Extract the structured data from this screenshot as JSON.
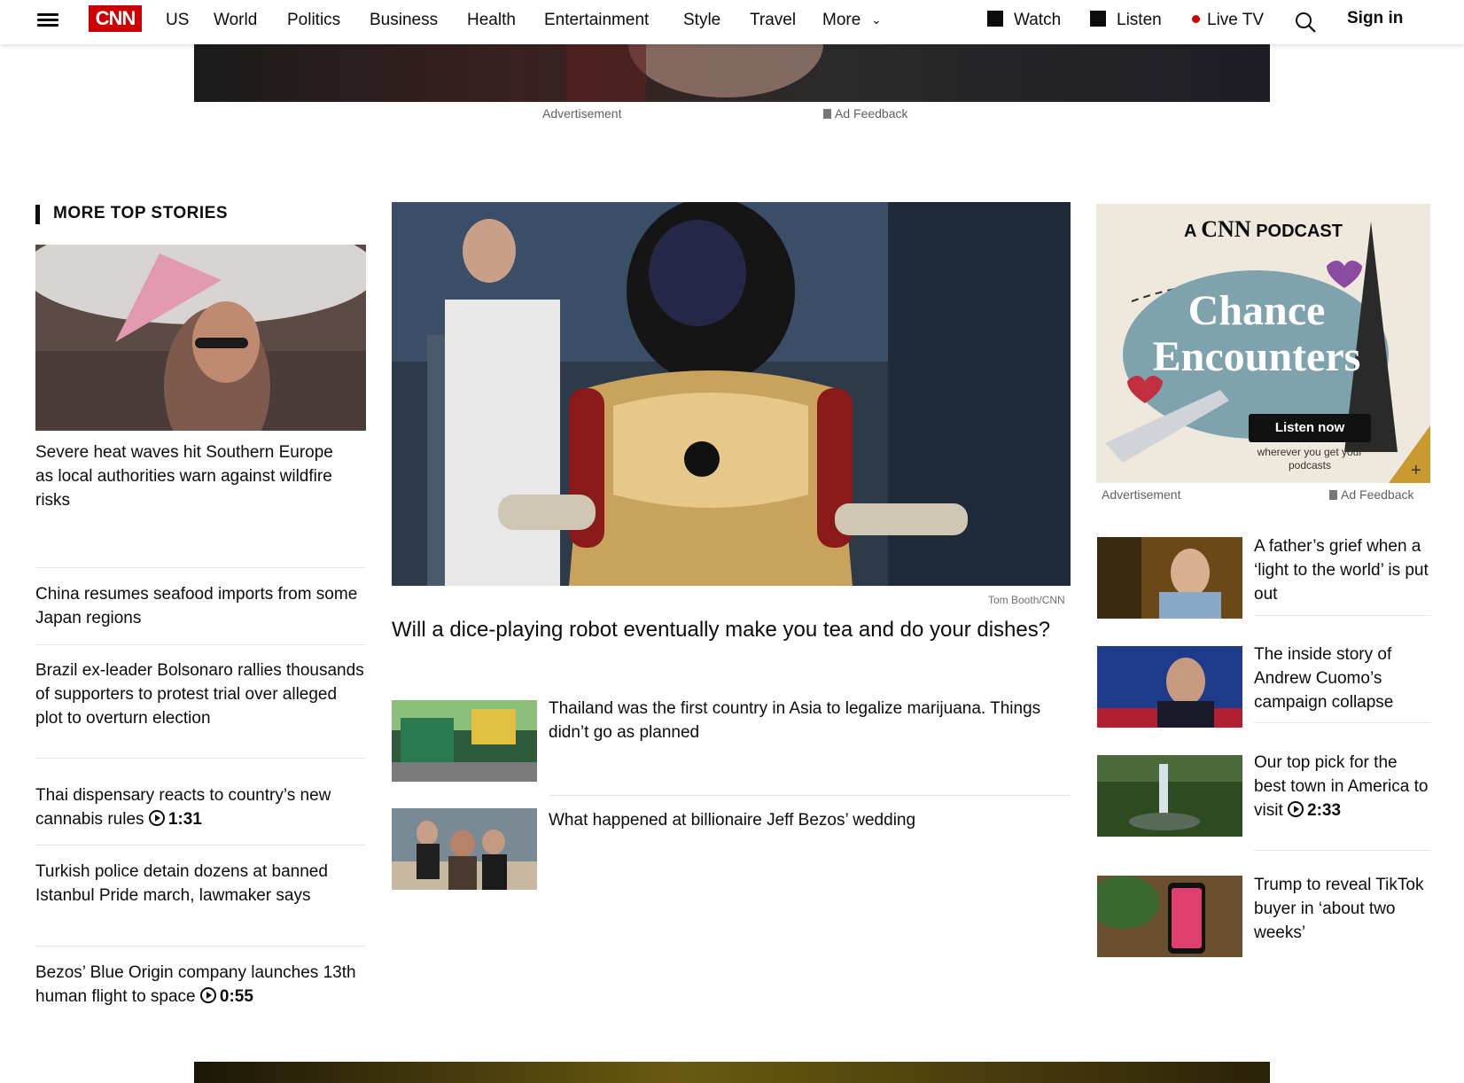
{
  "nav": {
    "menu_icon": "hamburger-icon",
    "logo": "CNN",
    "items": [
      "US",
      "World",
      "Politics",
      "Business",
      "Health",
      "Entertainment",
      "Style",
      "Travel",
      "More"
    ],
    "watch": "Watch",
    "listen": "Listen",
    "live_tv": "Live TV",
    "sign_in": "Sign in"
  },
  "top_ad": {
    "label": "Advertisement",
    "feedback": "Ad Feedback"
  },
  "more_top_stories": {
    "title": "MORE TOP STORIES",
    "stories": [
      {
        "headline": "Severe heat waves hit Southern Europe as local authorities warn against wildfire risks"
      },
      {
        "headline": "China resumes seafood imports from some Japan regions"
      },
      {
        "headline": "Brazil ex-leader Bolsonaro rallies thousands of supporters to protest trial over alleged plot to overturn election"
      },
      {
        "headline": "Thai dispensary reacts to country’s new cannabis rules",
        "duration": "1:31"
      },
      {
        "headline": "Turkish police detain dozens at banned Istanbul Pride march, lawmaker says"
      },
      {
        "headline": "Bezos’ Blue Origin company launches 13th human flight to space",
        "duration": "0:55"
      }
    ]
  },
  "center": {
    "credit": "Tom Booth/CNN",
    "lead_headline": "Will a dice-playing robot eventually make you tea and do your dishes?",
    "story2": "Thailand was the first country in Asia to legalize marijuana. Things didn’t go as planned",
    "story3": "What happened at billionaire Jeff Bezos’ wedding"
  },
  "podcast_ad": {
    "brand_prefix": "A",
    "brand": "CNN",
    "brand_suffix": "PODCAST",
    "title_line1": "Chance",
    "title_line2": "Encounters",
    "cta": "Listen now",
    "sub": "wherever you get your podcasts",
    "label": "Advertisement",
    "feedback": "Ad Feedback"
  },
  "right_stories": [
    {
      "headline": "A father’s grief when a ‘light to the world’ is put out"
    },
    {
      "headline": "The inside story of Andrew Cuomo’s campaign collapse"
    },
    {
      "headline": "Our top pick for the best town in America to visit",
      "duration": "2:33"
    },
    {
      "headline": "Trump to reveal TikTok buyer in ‘about two weeks’"
    }
  ],
  "colors": {
    "brand": "#cc0000",
    "text": "#0c0c0c"
  }
}
